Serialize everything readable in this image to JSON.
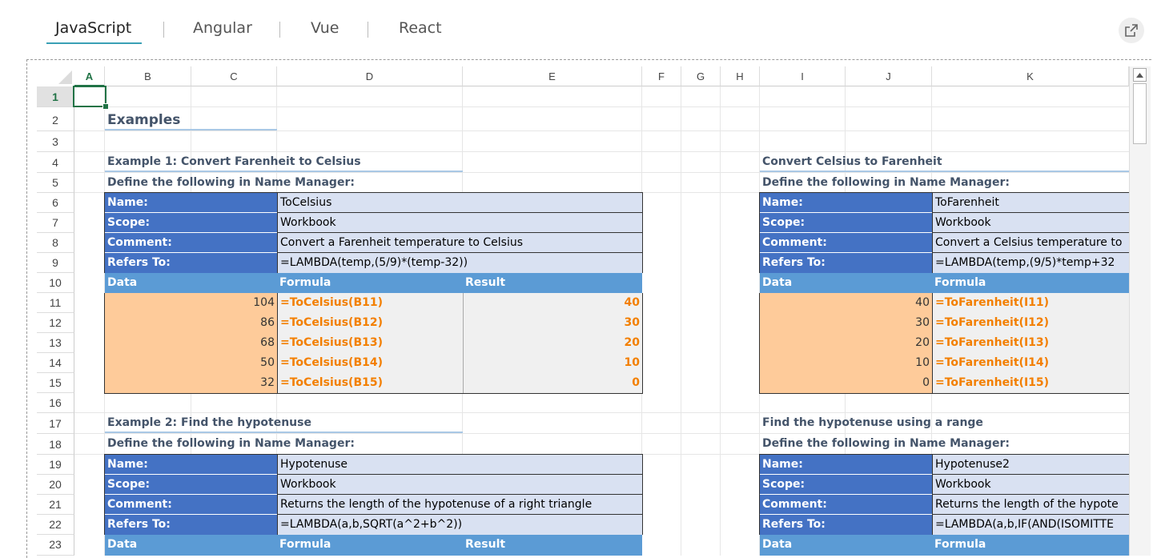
{
  "tabs": [
    {
      "label": "JavaScript",
      "active": true
    },
    {
      "label": "Angular",
      "active": false
    },
    {
      "label": "Vue",
      "active": false
    },
    {
      "label": "React",
      "active": false
    }
  ],
  "open_icon": "external-link-icon",
  "columns": [
    "A",
    "B",
    "C",
    "D",
    "E",
    "F",
    "G",
    "H",
    "I",
    "J",
    "K"
  ],
  "selected_column": "A",
  "rows": [
    "1",
    "2",
    "3",
    "4",
    "5",
    "6",
    "7",
    "8",
    "9",
    "10",
    "11",
    "12",
    "13",
    "14",
    "15",
    "16",
    "17",
    "18",
    "19",
    "20",
    "21",
    "22",
    "23"
  ],
  "selected_row": "1",
  "colors": {
    "header_dark": "#4472c4",
    "header_mid": "#5b9bd5",
    "light_fill": "#d9e1f2",
    "input_fill": "#fecb9a",
    "formula_color": "#f37f00",
    "selection": "#217346"
  },
  "sheet": {
    "title": "Examples",
    "ex1": {
      "heading": "Example 1: Convert Farenheit to Celsius",
      "define": "Define the following in Name Manager:",
      "name_label": "Name:",
      "name_value": "ToCelsius",
      "scope_label": "Scope:",
      "scope_value": "Workbook",
      "comment_label": "Comment:",
      "comment_value": "Convert a Farenheit temperature to Celsius",
      "refers_label": "Refers To:",
      "refers_value": "=LAMBDA(temp,(5/9)*(temp-32))",
      "col_data": "Data",
      "col_formula": "Formula",
      "col_result": "Result",
      "rows": [
        {
          "data": "104",
          "formula": "=ToCelsius(B11)",
          "result": "40"
        },
        {
          "data": "86",
          "formula": "=ToCelsius(B12)",
          "result": "30"
        },
        {
          "data": "68",
          "formula": "=ToCelsius(B13)",
          "result": "20"
        },
        {
          "data": "50",
          "formula": "=ToCelsius(B14)",
          "result": "10"
        },
        {
          "data": "32",
          "formula": "=ToCelsius(B15)",
          "result": "0"
        }
      ]
    },
    "ex1b": {
      "heading": "Convert Celsius to Farenheit",
      "define": "Define the following in Name Manager:",
      "name_label": "Name:",
      "name_value": "ToFarenheit",
      "scope_label": "Scope:",
      "scope_value": "Workbook",
      "comment_label": "Comment:",
      "comment_value": "Convert a Celsius temperature to",
      "refers_label": "Refers To:",
      "refers_value": "=LAMBDA(temp,(9/5)*temp+32",
      "col_data": "Data",
      "col_formula": "Formula",
      "rows": [
        {
          "data": "40",
          "formula": "=ToFarenheit(I11)"
        },
        {
          "data": "30",
          "formula": "=ToFarenheit(I12)"
        },
        {
          "data": "20",
          "formula": "=ToFarenheit(I13)"
        },
        {
          "data": "10",
          "formula": "=ToFarenheit(I14)"
        },
        {
          "data": "0",
          "formula": "=ToFarenheit(I15)"
        }
      ]
    },
    "ex2": {
      "heading": "Example 2: Find the hypotenuse",
      "define": "Define the following in Name Manager:",
      "name_label": "Name:",
      "name_value": "Hypotenuse",
      "scope_label": "Scope:",
      "scope_value": "Workbook",
      "comment_label": "Comment:",
      "comment_value": "Returns the length of the hypotenuse of a right triangle",
      "refers_label": "Refers To:",
      "refers_value": "=LAMBDA(a,b,SQRT(a^2+b^2))",
      "col_data": "Data",
      "col_formula": "Formula",
      "col_result": "Result"
    },
    "ex2b": {
      "heading": "Find the hypotenuse using a range",
      "define": "Define the following in Name Manager:",
      "name_label": "Name:",
      "name_value": "Hypotenuse2",
      "scope_label": "Scope:",
      "scope_value": "Workbook",
      "comment_label": "Comment:",
      "comment_value": "Returns the length of the hypote",
      "refers_label": "Refers To:",
      "refers_value": "=LAMBDA(a,b,IF(AND(ISOMITTE",
      "col_data": "Data",
      "col_formula": "Formula"
    }
  }
}
